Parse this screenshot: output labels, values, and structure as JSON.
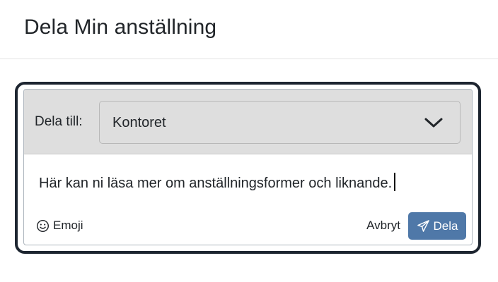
{
  "header": {
    "title": "Dela Min anställning"
  },
  "share_form": {
    "share_to_label": "Dela till:",
    "recipient": {
      "selected": "Kontoret",
      "icon": "chevron-down-icon"
    },
    "message_text": "Här kan ni läsa mer om anställningsformer och liknande.",
    "emoji_button": {
      "label": "Emoji",
      "icon": "smiley-icon"
    },
    "cancel_label": "Avbryt",
    "submit_button": {
      "label": "Dela",
      "icon": "paper-plane-icon",
      "color": "#4f78a8"
    }
  },
  "colors": {
    "focus_ring": "#1d2530",
    "card_top_bg": "#dedede"
  }
}
